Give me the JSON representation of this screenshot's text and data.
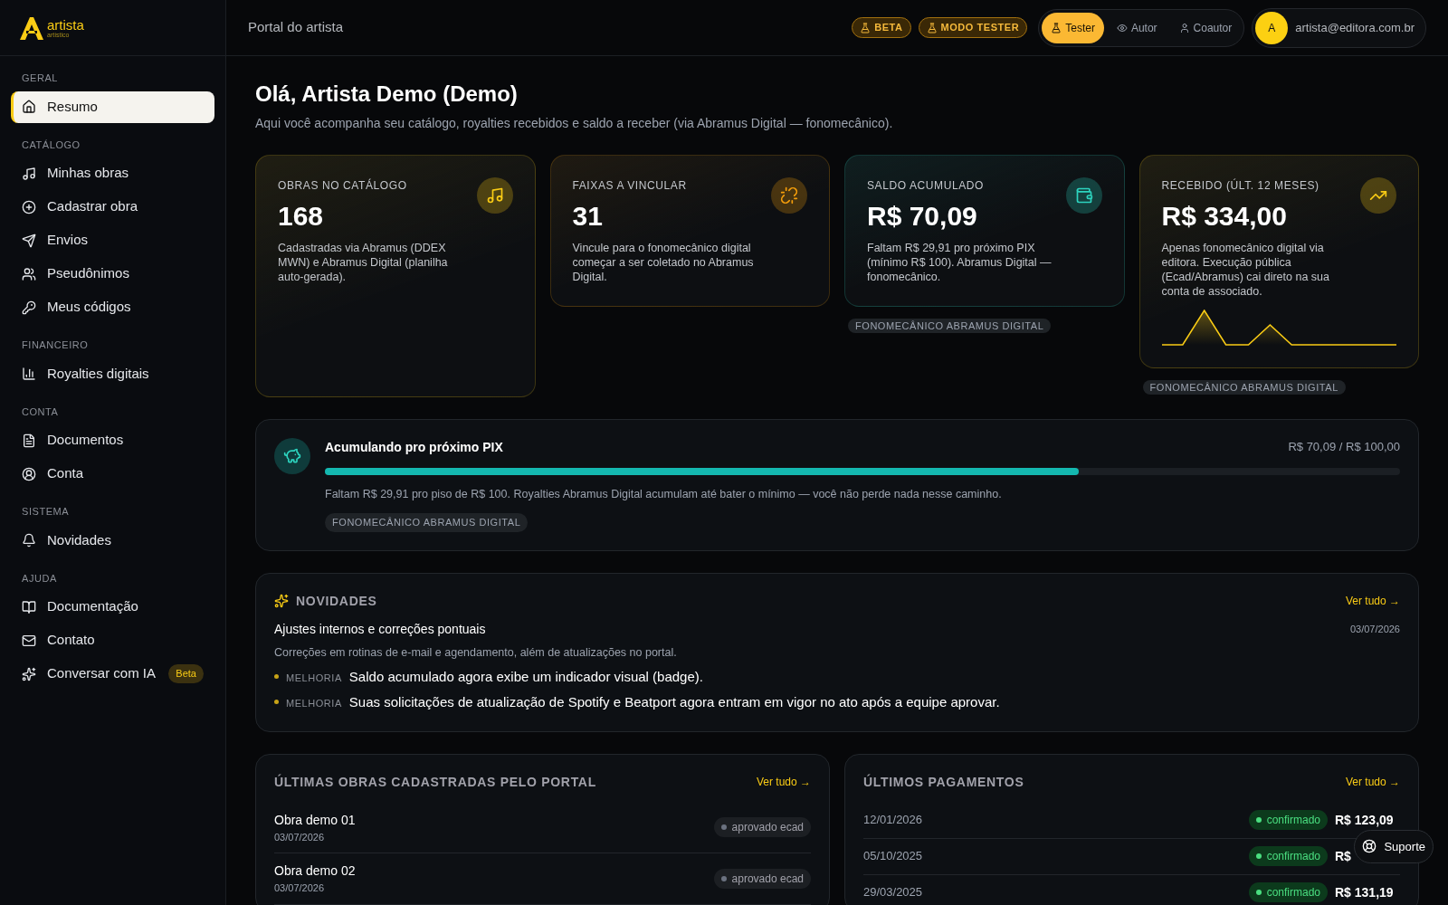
{
  "logo": {
    "name": "artista",
    "sub": "artístico"
  },
  "header": {
    "title": "Portal do artista",
    "badges": [
      "BETA",
      "MODO TESTER"
    ],
    "modes": [
      {
        "label": "Tester",
        "selected": true,
        "kind": "flask"
      },
      {
        "label": "Autor",
        "selected": false,
        "kind": "eye"
      },
      {
        "label": "Coautor",
        "selected": false,
        "kind": "user"
      }
    ],
    "user": {
      "initial": "A",
      "email": "artista@editora.com.br"
    }
  },
  "sidebar": [
    {
      "heading": "GERAL",
      "items": [
        {
          "label": "Resumo",
          "kind": "home",
          "selected": true
        }
      ]
    },
    {
      "heading": "CATÁLOGO",
      "items": [
        {
          "label": "Minhas obras",
          "kind": "music",
          "selected": false
        },
        {
          "label": "Cadastrar obra",
          "kind": "plus",
          "selected": false
        },
        {
          "label": "Envios",
          "kind": "send",
          "selected": false
        },
        {
          "label": "Pseudônimos",
          "kind": "users",
          "selected": false
        },
        {
          "label": "Meus códigos",
          "kind": "key",
          "selected": false
        }
      ]
    },
    {
      "heading": "FINANCEIRO",
      "items": [
        {
          "label": "Royalties digitais",
          "kind": "chart",
          "selected": false
        }
      ]
    },
    {
      "heading": "CONTA",
      "items": [
        {
          "label": "Documentos",
          "kind": "file",
          "selected": false
        },
        {
          "label": "Conta",
          "kind": "account",
          "selected": false
        }
      ]
    },
    {
      "heading": "SISTEMA",
      "items": [
        {
          "label": "Novidades",
          "kind": "bell",
          "selected": false
        }
      ]
    },
    {
      "heading": "AJUDA",
      "items": [
        {
          "label": "Documentação",
          "kind": "book",
          "selected": false
        },
        {
          "label": "Contato",
          "kind": "mail",
          "selected": false
        },
        {
          "label": "Conversar com IA",
          "kind": "sparkles",
          "selected": false,
          "badge": "Beta"
        }
      ]
    }
  ],
  "greeting": {
    "title": "Olá, Artista Demo (Demo)",
    "subtitle": "Aqui você acompanha seu catálogo, royalties recebidos e saldo a receber (via Abramus Digital — fonomecânico)."
  },
  "stats": [
    {
      "label": "OBRAS NO CATÁLOGO",
      "value": "168",
      "note": "Cadastradas via Abramus (DDEX MWN) e Abramus Digital (planilha auto-gerada).",
      "kind": "music",
      "color": "#facc15"
    },
    {
      "label": "FAIXAS A VINCULAR",
      "value": "31",
      "note": "Vincule para o fonomecânico digital começar a ser coletado no Abramus Digital.",
      "kind": "unlink",
      "color": "#f59e0b"
    },
    {
      "label": "SALDO ACUMULADO",
      "value": "R$ 70,09",
      "note": "Faltam R$ 29,91 pro próximo PIX (mínimo R$ 100). Abramus Digital — fonomecânico.",
      "kind": "wallet",
      "color": "#2dd4bf",
      "tag": "FONOMECÂNICO ABRAMUS DIGITAL"
    },
    {
      "label": "RECEBIDO (ÚLT. 12 MESES)",
      "value": "R$ 334,00",
      "note": "Apenas fonomecânico digital via editora. Execução pública (Ecad/Abramus) cai direto na sua conta de associado.",
      "kind": "trend",
      "color": "#facc15",
      "sparkline": true,
      "tag": "FONOMECÂNICO ABRAMUS DIGITAL"
    }
  ],
  "pix": {
    "title": "Acumulando pro próximo PIX",
    "reading": "R$ 70,09 / R$ 100,00",
    "level": 0.7009,
    "note": "Faltam R$ 29,91 pro piso de R$ 100. Royalties Abramus Digital acumulam até bater o mínimo — você não perde nada nesse caminho.",
    "tag": "FONOMECÂNICO ABRAMUS DIGITAL"
  },
  "news": {
    "heading": "NOVIDADES",
    "link": "Ver tudo →",
    "title": "Ajustes internos e correções pontuais",
    "date": "03/07/2026",
    "summary": "Correções em rotinas de e-mail e agendamento, além de atualizações no portal.",
    "items": [
      {
        "tag": "MELHORIA",
        "text": "Saldo acumulado agora exibe um indicador visual (badge)."
      },
      {
        "tag": "MELHORIA",
        "text": "Suas solicitações de atualização de Spotify e Beatport agora entram em vigor no ato após a equipe aprovar."
      }
    ]
  },
  "works": {
    "heading": "ÚLTIMAS OBRAS CADASTRADAS PELO PORTAL",
    "link": "Ver tudo →",
    "rows": [
      {
        "title": "Obra demo 01",
        "date": "03/07/2026",
        "status": "aprovado ecad"
      },
      {
        "title": "Obra demo 02",
        "date": "03/07/2026",
        "status": "aprovado ecad"
      }
    ]
  },
  "payments": {
    "heading": "ÚLTIMOS PAGAMENTOS",
    "link": "Ver tudo →",
    "rows": [
      {
        "date": "12/01/2026",
        "status": "confirmado",
        "amount": "R$ 123,09"
      },
      {
        "date": "05/10/2025",
        "status": "confirmado",
        "amount": "R$"
      },
      {
        "date": "29/03/2025",
        "status": "confirmado",
        "amount": "R$ 131,19"
      }
    ]
  },
  "support": {
    "label": "Suporte"
  }
}
